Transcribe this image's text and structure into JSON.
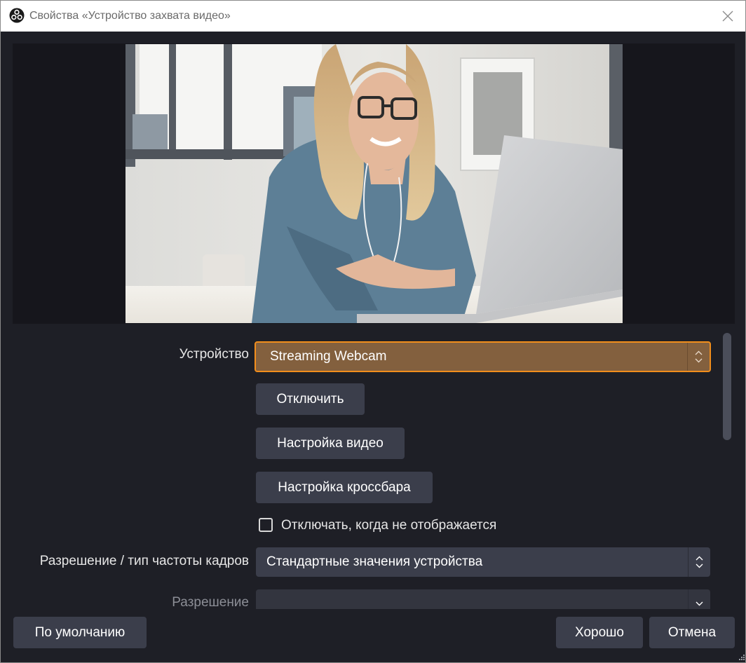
{
  "window": {
    "title": "Свойства «Устройство захвата видео»",
    "colors": {
      "background": "#1e1f26",
      "control": "#3b3e4b",
      "accent": "#f28e1c",
      "accent_fill": "#83603e"
    }
  },
  "icons": {
    "app": "obs-logo-icon",
    "close": "close-icon",
    "combo": "chevron-up-down-icon",
    "resize": "size-grip-icon"
  },
  "preview": {
    "description_icon": "webcam-preview-image"
  },
  "properties": {
    "device": {
      "label": "Устройство",
      "value": "Streaming Webcam"
    },
    "deactivate_button": "Отключить",
    "configure_video_button": "Настройка видео",
    "configure_crossbar_button": "Настройка кроссбара",
    "deactivate_when_hidden": {
      "label": "Отключать, когда не отображается",
      "checked": false
    },
    "resolution_type": {
      "label": "Разрешение / тип частоты кадров",
      "value": "Стандартные значения устройства"
    },
    "resolution": {
      "label": "Разрешение",
      "value": ""
    }
  },
  "footer": {
    "defaults_button": "По умолчанию",
    "ok_button": "Хорошо",
    "cancel_button": "Отмена"
  }
}
